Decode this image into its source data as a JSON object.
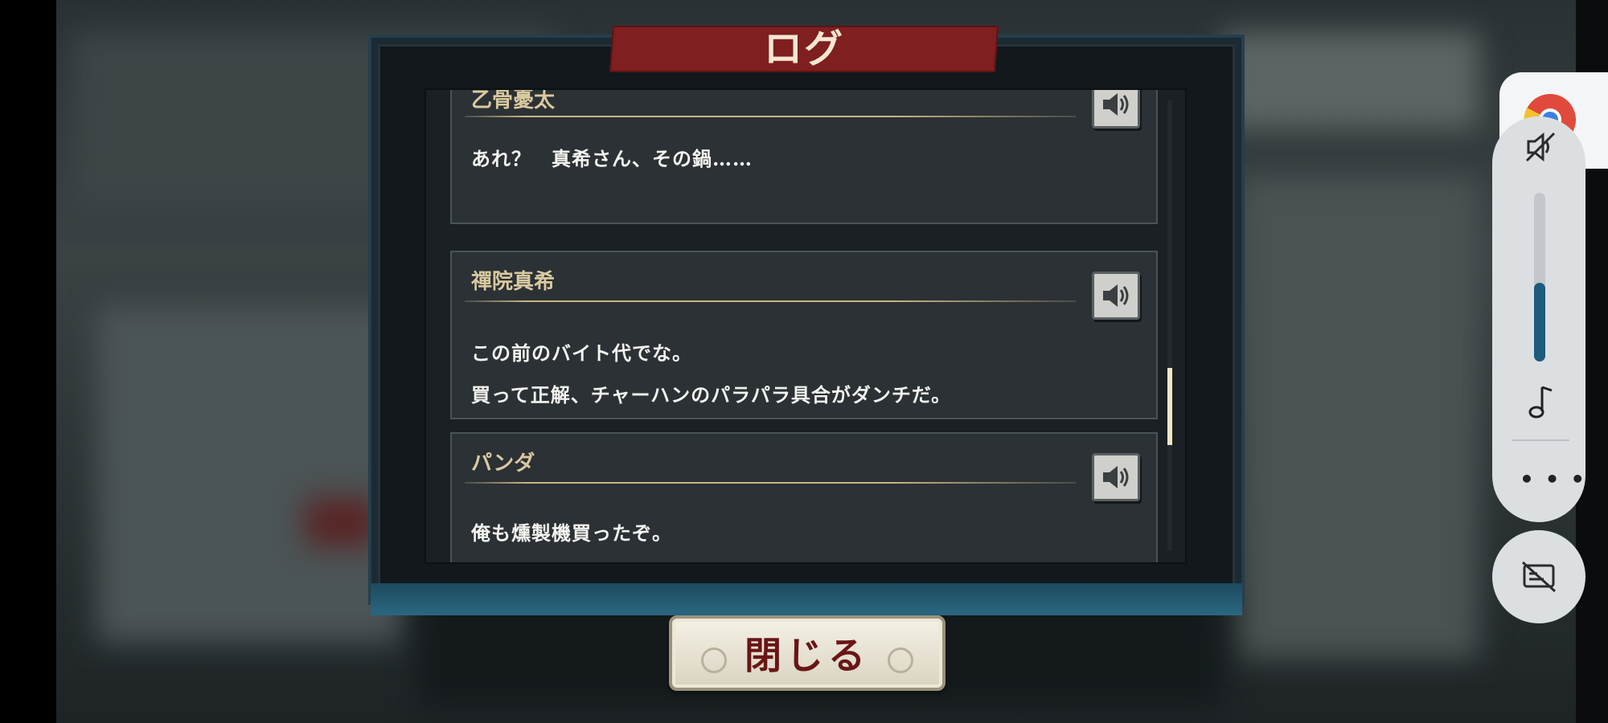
{
  "dialog": {
    "title": "ログ",
    "close_label": "閉じる"
  },
  "log_entries": [
    {
      "speaker": "乙骨憂太",
      "lines": [
        "あれ？　真希さん、その鍋……",
        ""
      ]
    },
    {
      "speaker": "禪院真希",
      "lines": [
        "この前のバイト代でな。",
        "買って正解、チャーハンのパラパラ具合がダンチだ。"
      ]
    },
    {
      "speaker": "パンダ",
      "lines": [
        "俺も燻製機買ったぞ。",
        ""
      ]
    }
  ],
  "icons": {
    "voice": "speaker-icon",
    "media_mute": "speaker-muted-icon",
    "music": "music-note-icon",
    "more": "more-dots-icon",
    "caption": "captions-off-icon",
    "browser": "chrome-icon"
  },
  "colors": {
    "title_banner": "#7f1f1f",
    "speaker_name": "#d9c9a0",
    "frame_teal": "#2a6781",
    "close_text": "#6a1515",
    "volume_fill": "#1d5b7c"
  },
  "media_panel": {
    "volume_level": 0.46
  }
}
